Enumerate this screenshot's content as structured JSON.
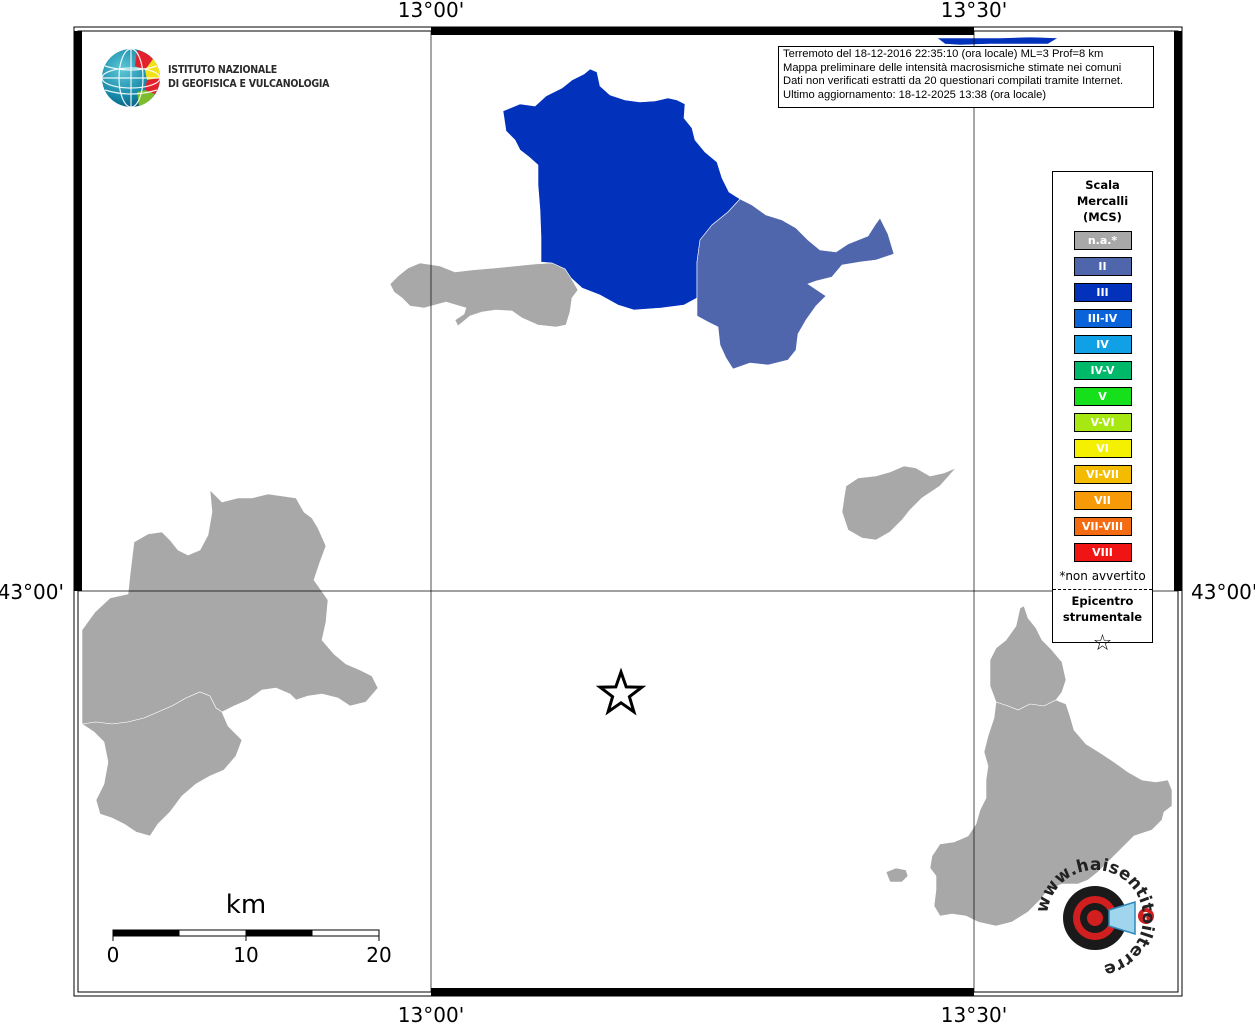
{
  "coords": {
    "top": [
      "13°00'",
      "13°30'"
    ],
    "bottom": [
      "13°00'",
      "13°30'"
    ],
    "left": "43°00'",
    "right": "43°00'"
  },
  "logo": {
    "line1": "ISTITUTO NAZIONALE",
    "line2": "DI GEOFISICA E VULCANOLOGIA"
  },
  "info": {
    "line1": "Terremoto del 18-12-2016 22:35:10 (ora locale) ML=3 Prof=8 km",
    "line2": "Mappa preliminare delle intensità macrosismiche stimate nei comuni",
    "line3": "Dati non verificati estratti da 20 questionari compilati tramite Internet.",
    "line4": "Ultimo aggiornamento: 18-12-2025 13:38 (ora locale)"
  },
  "legend": {
    "title1": "Scala",
    "title2": "Mercalli",
    "title3": "(MCS)",
    "items": [
      {
        "label": "n.a.*",
        "color": "#a8a8a8"
      },
      {
        "label": "II",
        "color": "#4f66ad"
      },
      {
        "label": "III",
        "color": "#0231bb"
      },
      {
        "label": "III-IV",
        "color": "#0a63d8"
      },
      {
        "label": "IV",
        "color": "#0fa0e6"
      },
      {
        "label": "IV-V",
        "color": "#00b86a"
      },
      {
        "label": "V",
        "color": "#16e01c"
      },
      {
        "label": "V-VI",
        "color": "#a8e812"
      },
      {
        "label": "VI",
        "color": "#f5ef00"
      },
      {
        "label": "VI-VII",
        "color": "#f4bc00"
      },
      {
        "label": "VII",
        "color": "#f79a08"
      },
      {
        "label": "VII-VIII",
        "color": "#f56b12"
      },
      {
        "label": "VIII",
        "color": "#f01414"
      }
    ],
    "note": "*non avvertito",
    "epicentre1": "Epicentro",
    "epicentre2": "strumentale",
    "star": "☆"
  },
  "scale": {
    "unit": "km",
    "ticks": [
      "0",
      "10",
      "20"
    ]
  },
  "watermark": {
    "text": "www.haisentitoilterremoto.it"
  },
  "colors": {
    "na": "#a8a8a8",
    "ii": "#4f66ad",
    "iii": "#0231bb"
  }
}
